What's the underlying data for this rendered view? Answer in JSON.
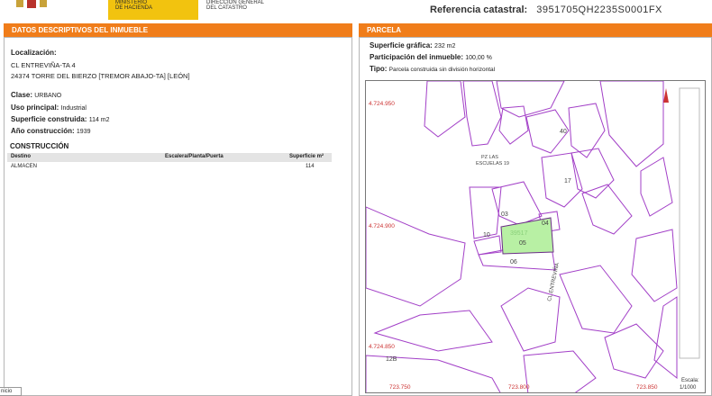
{
  "header": {
    "ministry": "MINISTERIO\nDE HACIENDA",
    "directorate": "DIRECCIÓN GENERAL\nDEL CATASTRO",
    "ref_label": "Referencia catastral:",
    "ref_value": "3951705QH2235S0001FX"
  },
  "left_panel": {
    "title": "DATOS DESCRIPTIVOS DEL INMUEBLE",
    "localizacion_label": "Localización:",
    "address_line1": "CL ENTREVIÑA-TA 4",
    "address_line2": "24374 TORRE DEL BIERZO [TREMOR ABAJO-TA] [LEÓN]",
    "clase_label": "Clase:",
    "clase_value": "URBANO",
    "uso_label": "Uso principal:",
    "uso_value": "Industrial",
    "sup_label": "Superficie construida:",
    "sup_value": "114 m2",
    "anio_label": "Año construcción:",
    "anio_value": "1939",
    "construccion_title": "CONSTRUCCIÓN",
    "table": {
      "headers": [
        "Destino",
        "Escalera/Planta/Puerta",
        "Superficie m²"
      ],
      "rows": [
        [
          "ALMACEN",
          "",
          "114"
        ]
      ]
    }
  },
  "right_panel": {
    "title": "PARCELA",
    "sup_grafica_label": "Superficie gráfica:",
    "sup_grafica_value": "232 m2",
    "participacion_label": "Participación del inmueble:",
    "participacion_value": "100,00 %",
    "tipo_label": "Tipo:",
    "tipo_value": "Parcela construida sin división horizontal"
  },
  "map": {
    "y_ticks": [
      "4.724.950",
      "4.724.900",
      "4.724.850"
    ],
    "x_ticks": [
      "723.750",
      "723.800",
      "723.850"
    ],
    "plot_labels": [
      "03",
      "04",
      "05",
      "06",
      "10",
      "17",
      "40",
      "12B"
    ],
    "highlight_label": "39517",
    "square_label": "PZ LAS\nESCUELAS 19",
    "street_label": "CL ENTREVIÑA",
    "scale_label": "Escala:",
    "scale_value": "1/1000",
    "highlight_color": "#b8f0a4",
    "parcel_color": "#a23fc7"
  },
  "footer": {
    "start_label": "nicio"
  }
}
